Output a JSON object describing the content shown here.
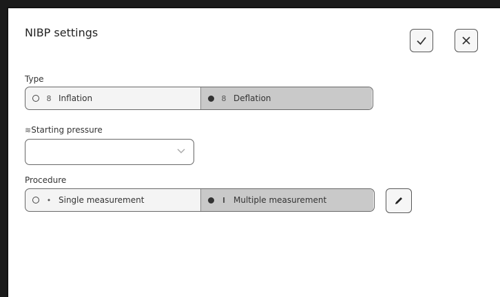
{
  "dialog": {
    "title": "NIBP settings",
    "confirm_icon": "checkmark-icon",
    "close_icon": "close-icon"
  },
  "type": {
    "label": "Type",
    "options": [
      {
        "label": "Inflation",
        "icon": "inflation-icon",
        "selected": false
      },
      {
        "label": "Deflation",
        "icon": "deflation-icon",
        "selected": true
      }
    ]
  },
  "starting_pressure": {
    "label": "Starting pressure",
    "icon": "pressure-icon",
    "value": ""
  },
  "procedure": {
    "label": "Procedure",
    "options": [
      {
        "label": "Single measurement",
        "icon": "single-dot-icon",
        "selected": false
      },
      {
        "label": "Multiple measurement",
        "icon": "multiple-bar-icon",
        "selected": true
      }
    ],
    "edit_icon": "pencil-icon"
  },
  "colors": {
    "selected_bg": "#c9c9c9",
    "unselected_bg": "#f4f4f4",
    "border": "#666666"
  }
}
